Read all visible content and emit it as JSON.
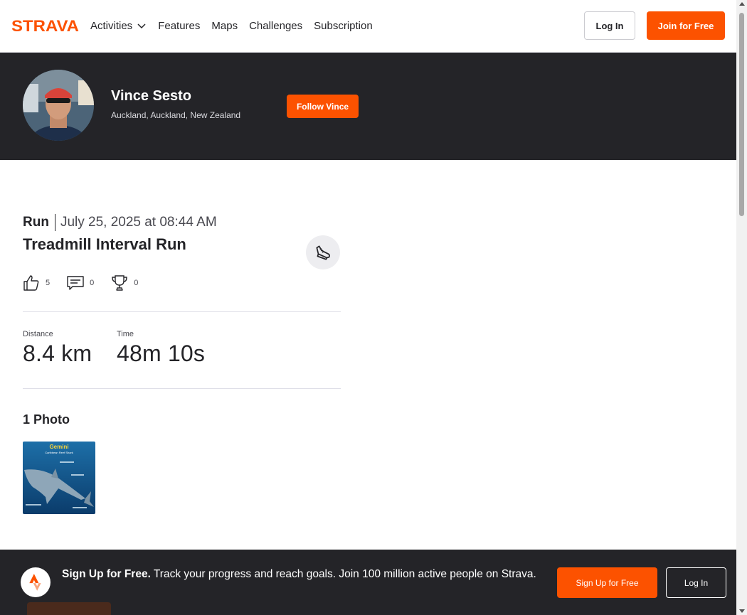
{
  "brand": {
    "name": "STRAVA",
    "accent": "#fc5200",
    "dark": "#242428"
  },
  "nav": {
    "items": [
      {
        "label": "Activities",
        "has_dropdown": true
      },
      {
        "label": "Features"
      },
      {
        "label": "Maps"
      },
      {
        "label": "Challenges"
      },
      {
        "label": "Subscription"
      }
    ],
    "login_label": "Log In",
    "join_label": "Join for Free"
  },
  "athlete": {
    "name": "Vince Sesto",
    "location": "Auckland, Auckland, New Zealand",
    "follow_label": "Follow Vince"
  },
  "activity": {
    "type": "Run",
    "date": "July 25, 2025 at 08:44 AM",
    "title": "Treadmill Interval Run",
    "kudos_count": "5",
    "comments_count": "0",
    "achievements_count": "0",
    "stats": [
      {
        "label": "Distance",
        "value": "8.4 km"
      },
      {
        "label": "Time",
        "value": "48m 10s"
      }
    ]
  },
  "photos": {
    "heading": "1 Photo",
    "thumb_texts": {
      "title": "Gemini",
      "subtitle": "Caribbean Reef Shark"
    }
  },
  "signup_banner": {
    "headline": "Sign Up for Free.",
    "body": " Track your progress and reach goals. Join 100 million active people on Strava.",
    "signup_label": "Sign Up for Free",
    "login_label": "Log In"
  }
}
